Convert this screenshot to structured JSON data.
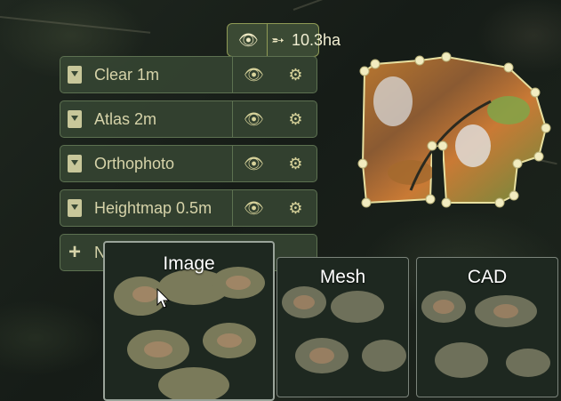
{
  "area": {
    "value": "10.3ha",
    "view_icon": "eye-icon",
    "share_icon": "share-icon"
  },
  "layers": [
    {
      "label": "Clear 1m",
      "icon": "download-file-icon"
    },
    {
      "label": "Atlas 2m",
      "icon": "download-file-icon"
    },
    {
      "label": "Orthophoto",
      "icon": "download-file-icon"
    },
    {
      "label": "Heightmap 0.5m",
      "icon": "download-file-icon"
    }
  ],
  "add_layer": {
    "label": "N",
    "icon": "plus-icon"
  },
  "styles": [
    {
      "label": "Image"
    },
    {
      "label": "Mesh"
    },
    {
      "label": "CAD"
    }
  ],
  "colors": {
    "panel_bg": "#384834",
    "panel_border": "#5d7151",
    "accent": "#d8d39b",
    "pill_border": "#8f9a55"
  }
}
